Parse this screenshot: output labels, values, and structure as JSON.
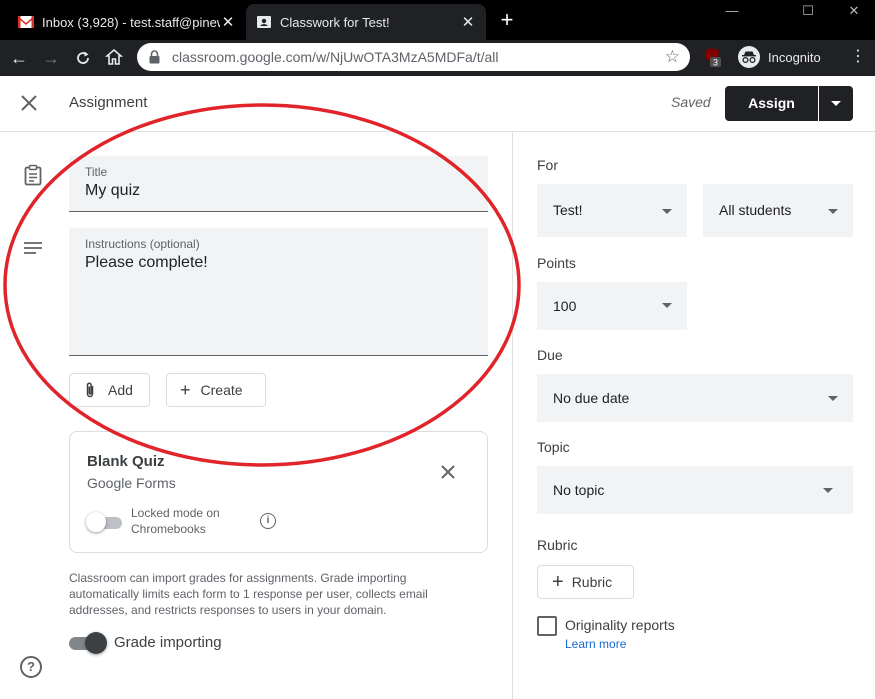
{
  "browser": {
    "tabs": [
      {
        "title": "Inbox (3,928) - test.staff@pinewo",
        "favicon": "gmail-icon",
        "active": false
      },
      {
        "title": "Classwork for Test!",
        "favicon": "classroom-icon",
        "active": true
      }
    ],
    "url": "classroom.google.com/w/NjUwOTA3MzA5MDFa/t/all",
    "extension_badge": "3",
    "profile_label": "Incognito"
  },
  "header": {
    "title": "Assignment",
    "status": "Saved",
    "assign_label": "Assign"
  },
  "form": {
    "title_label": "Title",
    "title_value": "My quiz",
    "instructions_label": "Instructions (optional)",
    "instructions_value": "Please complete!",
    "add_label": "Add",
    "create_label": "Create"
  },
  "attachment": {
    "name": "Blank Quiz",
    "source": "Google Forms",
    "locked_mode_label": "Locked mode on Chromebooks",
    "locked_mode_on": false
  },
  "grade_import": {
    "note": "Classroom can import grades for assignments. Grade importing automatically limits each form to 1 response per user, collects email addresses, and restricts responses to users in your domain.",
    "toggle_label": "Grade importing",
    "enabled": true
  },
  "settings": {
    "for_label": "For",
    "class_value": "Test!",
    "students_value": "All students",
    "points_label": "Points",
    "points_value": "100",
    "due_label": "Due",
    "due_value": "No due date",
    "topic_label": "Topic",
    "topic_value": "No topic",
    "rubric_label": "Rubric",
    "rubric_button": "Rubric",
    "originality_label": "Originality reports",
    "learn_more": "Learn more"
  },
  "colors": {
    "annotation_ellipse": "#e0242a",
    "link": "#1967d2",
    "assign_button": "#202124"
  }
}
